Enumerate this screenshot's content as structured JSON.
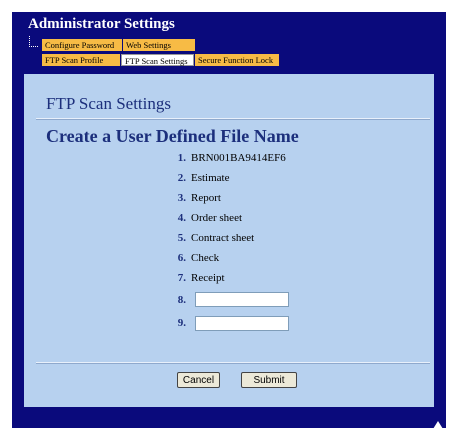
{
  "header": {
    "title": "Administrator Settings"
  },
  "nav": {
    "row1": [
      "Configure Password",
      "Web Settings"
    ],
    "row2": [
      "FTP Scan Profile",
      "FTP Scan Settings",
      "Secure Function Lock"
    ]
  },
  "page": {
    "title": "FTP Scan Settings",
    "section_title": "Create a User Defined File Name"
  },
  "file_names": [
    {
      "num": "1.",
      "value": "BRN001BA9414EF6"
    },
    {
      "num": "2.",
      "value": "Estimate"
    },
    {
      "num": "3.",
      "value": "Report"
    },
    {
      "num": "4.",
      "value": "Order sheet"
    },
    {
      "num": "5.",
      "value": "Contract sheet"
    },
    {
      "num": "6.",
      "value": "Check"
    },
    {
      "num": "7.",
      "value": "Receipt"
    }
  ],
  "custom_fields": [
    {
      "num": "8.",
      "value": ""
    },
    {
      "num": "9.",
      "value": ""
    }
  ],
  "buttons": {
    "cancel": "Cancel",
    "submit": "Submit"
  },
  "colors": {
    "frame": "#0a0a7c",
    "panel": "#b7d1ef",
    "tab": "#f7bb45",
    "heading": "#1c2f7c"
  }
}
